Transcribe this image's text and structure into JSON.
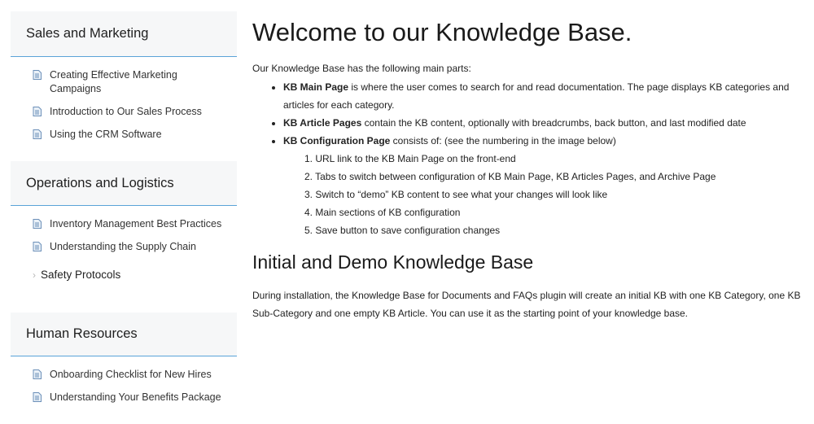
{
  "sidebar": {
    "sections": [
      {
        "title": "Sales and Marketing",
        "articles": [
          "Creating Effective Marketing Campaigns",
          "Introduction to Our Sales Process",
          "Using the CRM Software"
        ]
      },
      {
        "title": "Operations and Logistics",
        "articles": [
          "Inventory Management Best Practices",
          "Understanding the Supply Chain"
        ],
        "subcategory": "Safety Protocols"
      },
      {
        "title": "Human Resources",
        "articles": [
          "Onboarding Checklist for New Hires",
          "Understanding Your Benefits Package"
        ]
      }
    ]
  },
  "main": {
    "title": "Welcome to our Knowledge Base.",
    "intro": "Our Knowledge Base has the following main parts:",
    "parts": [
      {
        "bold": "KB Main Page",
        "text": " is where the user comes to search for and read documentation. The page displays KB categories and articles for each category."
      },
      {
        "bold": "KB Article Pages",
        "text": " contain the KB content, optionally with breadcrumbs, back button, and last modified date"
      },
      {
        "bold": "KB Configuration Page",
        "text": " consists of: (see the numbering in the image below)"
      }
    ],
    "steps": [
      "1. URL link to the KB Main Page on the front-end",
      "2. Tabs to switch between configuration of KB Main Page, KB Articles Pages, and Archive Page",
      "3. Switch to “demo” KB content to see what your changes will look like",
      "4. Main sections of KB configuration",
      "5. Save button to save configuration changes"
    ],
    "subtitle": "Initial and Demo Knowledge Base",
    "paragraph": "During installation, the Knowledge Base for Documents and FAQs plugin will create an initial KB with one KB Category, one KB Sub-Category and one empty KB Article. You can use it as the starting point of your knowledge base."
  },
  "icons": {
    "article": "document-icon",
    "subcategory": "chevron-right-icon"
  },
  "colors": {
    "accent_border": "#5aa3d8",
    "icon": "#6b8fb8",
    "section_bg": "#f6f7f8"
  }
}
